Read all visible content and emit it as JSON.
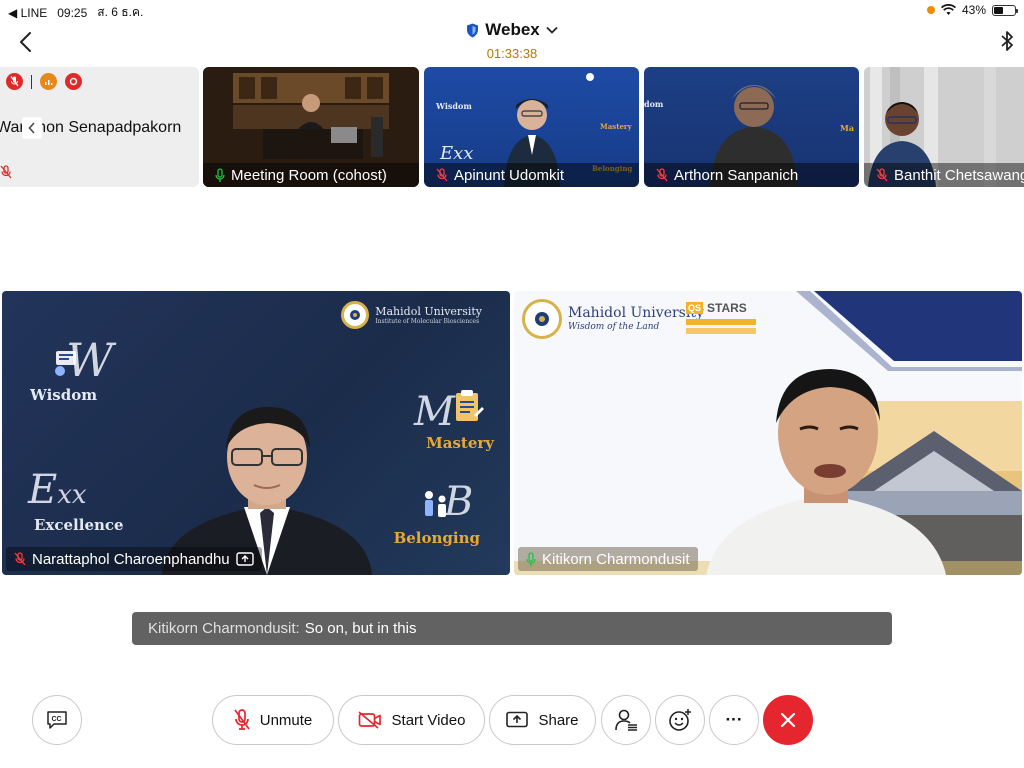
{
  "status_bar": {
    "back_app": "◀ LINE",
    "time": "09:25",
    "date": "ส. 6 ธ.ค.",
    "battery": "43%"
  },
  "header": {
    "title": "Webex",
    "timer": "01:33:38"
  },
  "thumbnails": [
    {
      "name": "Wan  mon Senapadpakorn",
      "muted": true
    },
    {
      "name": "Meeting Room (cohost)",
      "muted": false
    },
    {
      "name": "Apinunt Udomkit",
      "muted": true
    },
    {
      "name": "Arthorn Sanpanich",
      "muted": true
    },
    {
      "name": "Banthit Chetsawang",
      "muted": true
    }
  ],
  "backgrounds": {
    "wisdom": "Wisdom",
    "excellence": "Excellence",
    "mastery": "Mastery",
    "belonging": "Belonging",
    "mu_name": "Mahidol University",
    "mu_sub": "Institute of Molecular Biosciences",
    "mu_slogan": "Wisdom of the Land",
    "stars": "STARS"
  },
  "main_tiles": [
    {
      "name": "Narattaphol Charoenphandhu",
      "muted": true,
      "sharing": true
    },
    {
      "name": "Kitikorn Charmondusit",
      "muted": false,
      "sharing": false
    }
  ],
  "caption": {
    "speaker": "Kitikorn Charmondusit:",
    "text": "So on, but in this"
  },
  "toolbar": {
    "unmute": "Unmute",
    "start_video": "Start Video",
    "share": "Share",
    "more": "···"
  },
  "colors": {
    "accent_red": "#e5262f",
    "timer": "#b07a00",
    "webex_blue": "#1a56c4",
    "mic_green": "#20c443"
  }
}
